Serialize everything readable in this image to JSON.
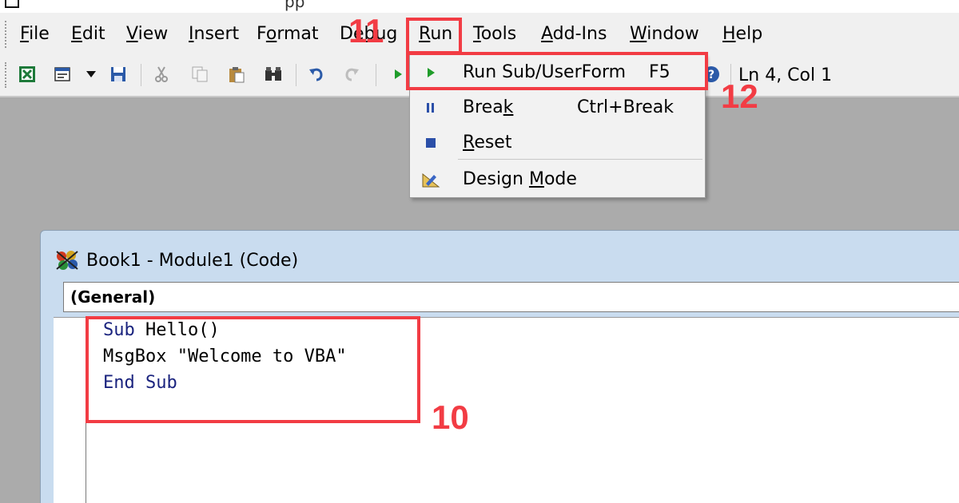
{
  "title_fragment": "pp",
  "menubar": {
    "items": [
      {
        "pre": "",
        "ul": "F",
        "post": "ile"
      },
      {
        "pre": "",
        "ul": "E",
        "post": "dit"
      },
      {
        "pre": "",
        "ul": "V",
        "post": "iew"
      },
      {
        "pre": "",
        "ul": "I",
        "post": "nsert"
      },
      {
        "pre": "F",
        "ul": "o",
        "post": "rmat"
      },
      {
        "pre": "De",
        "ul": "b",
        "post": "ug"
      },
      {
        "pre": "",
        "ul": "R",
        "post": "un"
      },
      {
        "pre": "",
        "ul": "T",
        "post": "ools"
      },
      {
        "pre": "",
        "ul": "A",
        "post": "dd-Ins"
      },
      {
        "pre": "",
        "ul": "W",
        "post": "indow"
      },
      {
        "pre": "",
        "ul": "H",
        "post": "elp"
      }
    ]
  },
  "toolbar": {
    "position_readout": "Ln 4, Col 1",
    "icons": [
      "excel-icon",
      "insert-userform-icon",
      "dropdown-arrow-icon",
      "save-icon",
      "cut-icon",
      "copy-icon",
      "paste-icon",
      "find-icon",
      "undo-icon",
      "redo-icon",
      "run-icon",
      "help-icon"
    ]
  },
  "run_menu": {
    "items": [
      {
        "label": "Run Sub/UserForm",
        "shortcut": "F5",
        "icon": "play-icon"
      },
      {
        "label_pre": "Brea",
        "label_ul": "k",
        "label_post": "",
        "shortcut": "Ctrl+Break",
        "icon": "pause-icon"
      },
      {
        "label_pre": "",
        "label_ul": "R",
        "label_post": "eset",
        "shortcut": "",
        "icon": "stop-icon"
      },
      {
        "label_pre": "Design ",
        "label_ul": "M",
        "label_post": "ode",
        "shortcut": "",
        "icon": "design-mode-icon"
      }
    ]
  },
  "code_window": {
    "title": "Book1 - Module1 (Code)",
    "procedure_dropdown": "(General)",
    "lines": [
      {
        "kw": "Sub",
        "rest": " Hello()"
      },
      {
        "kw": "",
        "rest": "MsgBox \"Welcome to VBA\""
      },
      {
        "kw": "End Sub",
        "rest": ""
      }
    ]
  },
  "annotations": {
    "code_box_number": "10",
    "run_menu_number": "11",
    "run_item_number": "12",
    "color": "#f23c44"
  },
  "colors": {
    "keyword": "#1a237e",
    "workspace": "#ababab",
    "window_frame": "#c9dcef"
  }
}
